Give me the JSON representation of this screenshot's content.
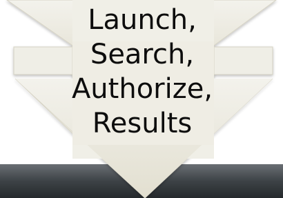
{
  "arrow": {
    "lines": [
      "Launch,",
      "Search,",
      "Authorize,",
      "Results"
    ],
    "fill_top": "#f2f1ea",
    "fill_bottom": "#e3e0d2",
    "stroke": "#d8d5c6"
  },
  "footer_bar": {
    "color_top": "#5a5f64",
    "color_bottom": "#2b2f33"
  }
}
